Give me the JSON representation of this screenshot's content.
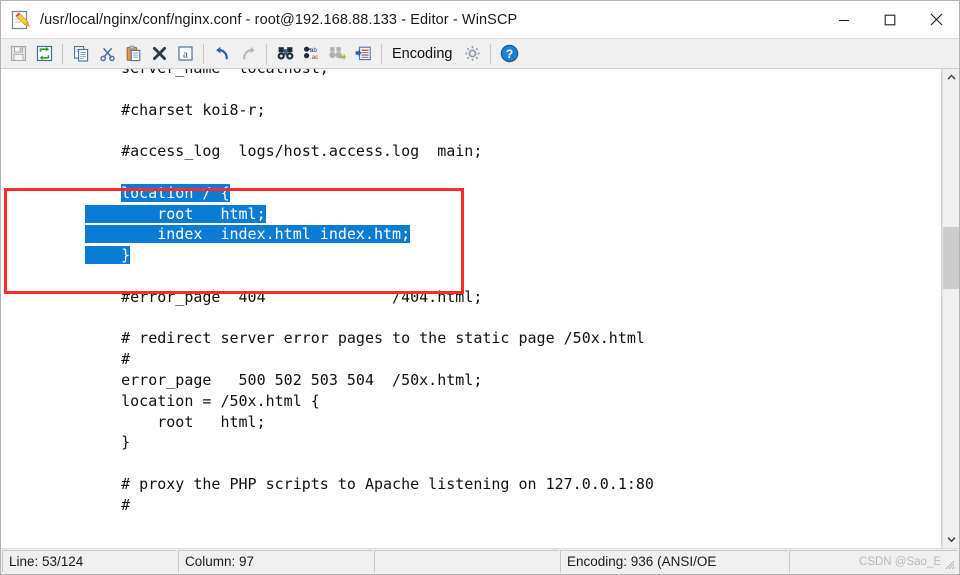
{
  "window": {
    "title": "/usr/local/nginx/conf/nginx.conf - root@192.168.88.133 - Editor - WinSCP",
    "icon": "editor-notepad-pencil-icon",
    "controls": {
      "minimize": "minimize-icon",
      "maximize": "maximize-icon",
      "close": "close-icon"
    }
  },
  "toolbar": {
    "items": [
      {
        "name": "save-button",
        "icon": "floppy-disk-icon",
        "enabled": false
      },
      {
        "name": "reload-button",
        "icon": "refresh-arrows-icon",
        "enabled": true
      },
      {
        "name": "copy-button",
        "icon": "copy-pages-icon",
        "enabled": true
      },
      {
        "name": "cut-button",
        "icon": "scissors-icon",
        "enabled": true
      },
      {
        "name": "paste-button",
        "icon": "clipboard-icon",
        "enabled": true
      },
      {
        "name": "delete-button",
        "icon": "x-cross-icon",
        "enabled": true
      },
      {
        "name": "select-all-button",
        "icon": "letter-a-box-icon",
        "enabled": true
      },
      {
        "name": "undo-button",
        "icon": "undo-arrow-icon",
        "enabled": true
      },
      {
        "name": "redo-button",
        "icon": "redo-arrow-icon",
        "enabled": false
      },
      {
        "name": "find-button",
        "icon": "binoculars-icon",
        "enabled": true
      },
      {
        "name": "replace-button",
        "icon": "replace-ab-ac-icon",
        "enabled": true
      },
      {
        "name": "find-next-button",
        "icon": "binoculars-next-icon",
        "enabled": false
      },
      {
        "name": "go-to-line-button",
        "icon": "goto-line-icon",
        "enabled": true
      }
    ],
    "encoding_label": "Encoding",
    "preferences_icon": "gear-icon",
    "help_icon": "question-mark-help-icon"
  },
  "editor": {
    "selection_color": "#0b7cd4",
    "annotation_color": "#fb2b2b",
    "lines": [
      {
        "text": "    server_name  localhost;",
        "selected": false
      },
      {
        "text": "",
        "selected": false
      },
      {
        "text": "    #charset koi8-r;",
        "selected": false
      },
      {
        "text": "",
        "selected": false
      },
      {
        "text": "    #access_log  logs/host.access.log  main;",
        "selected": false
      },
      {
        "text": "",
        "selected": false
      },
      {
        "text": "    location / {",
        "selected": true,
        "sel_from": 4
      },
      {
        "text": "        root   html;",
        "selected": true,
        "sel_from": 0
      },
      {
        "text": "        index  index.html index.htm;",
        "selected": true,
        "sel_from": 0
      },
      {
        "text": "    }",
        "selected": true,
        "sel_from": 0
      },
      {
        "text": "",
        "selected": false
      },
      {
        "text": "    #error_page  404              /404.html;",
        "selected": false
      },
      {
        "text": "",
        "selected": false
      },
      {
        "text": "    # redirect server error pages to the static page /50x.html",
        "selected": false
      },
      {
        "text": "    #",
        "selected": false
      },
      {
        "text": "    error_page   500 502 503 504  /50x.html;",
        "selected": false
      },
      {
        "text": "    location = /50x.html {",
        "selected": false
      },
      {
        "text": "        root   html;",
        "selected": false
      },
      {
        "text": "    }",
        "selected": false
      },
      {
        "text": "",
        "selected": false
      },
      {
        "text": "    # proxy the PHP scripts to Apache listening on 127.0.0.1:80",
        "selected": false
      },
      {
        "text": "    #",
        "selected": false
      }
    ]
  },
  "scrollbar": {
    "up_arrow": "chevron-up-icon",
    "down_arrow": "chevron-down-icon"
  },
  "statusbar": {
    "line": "Line: 53/124",
    "column": "Column: 97",
    "blank1": "",
    "encoding": "Encoding: 936  (ANSI/OE",
    "watermark": "CSDN @Sao_E"
  }
}
